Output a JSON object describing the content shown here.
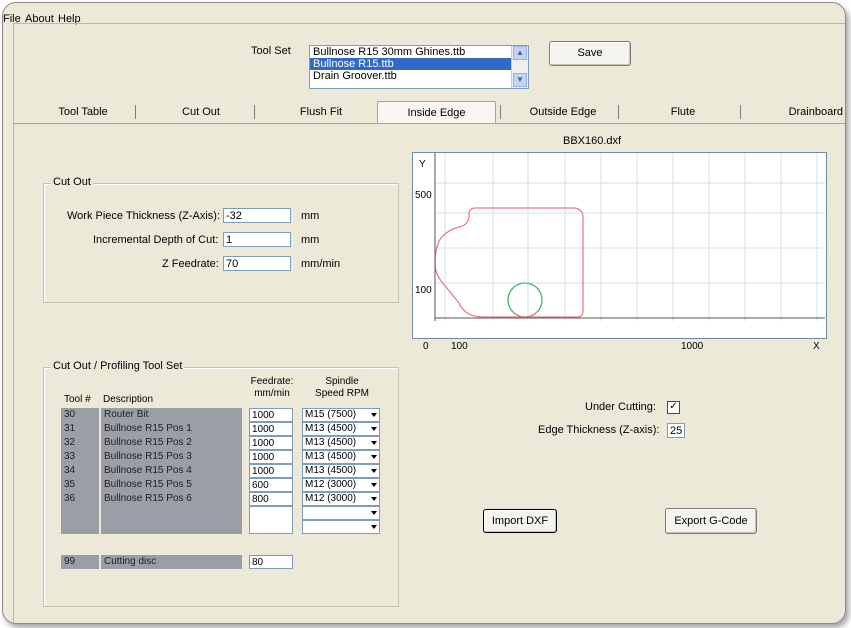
{
  "menu": [
    "File",
    "About",
    "Help"
  ],
  "toolset": {
    "label": "Tool Set",
    "options": [
      "Bullnose R15 30mm Ghines.ttb",
      "Bullnose R15.ttb",
      "Drain Groover.ttb"
    ],
    "selected_index": 1,
    "save_label": "Save"
  },
  "tabs": [
    "Tool Table",
    "Cut Out",
    "Flush Fit",
    "Inside Edge",
    "Outside Edge",
    "Flute",
    "Drainboard"
  ],
  "active_tab": "Inside Edge",
  "cutout": {
    "title": "Cut Out",
    "thickness_label": "Work Piece Thickness (Z-Axis):",
    "thickness_value": "-32",
    "thickness_unit": "mm",
    "depth_label": "Incremental Depth of Cut:",
    "depth_value": "1",
    "depth_unit": "mm",
    "feed_label": "Z Feedrate:",
    "feed_value": "70",
    "feed_unit": "mm/min"
  },
  "toolset_table": {
    "title": "Cut Out / Profiling Tool Set",
    "col_tool": "Tool #",
    "col_desc": "Description",
    "col_feed_1": "Feedrate:",
    "col_feed_2": "mm/min",
    "col_spindle_1": "Spindle",
    "col_spindle_2": "Speed RPM",
    "rows": [
      {
        "tool": "30",
        "desc": "Router Bit",
        "feed": "1000",
        "spindle": "M15 (7500)"
      },
      {
        "tool": "31",
        "desc": "Bullnose R15 Pos 1",
        "feed": "1000",
        "spindle": "M13 (4500)"
      },
      {
        "tool": "32",
        "desc": "Bullnose R15 Pos 2",
        "feed": "1000",
        "spindle": "M13 (4500)"
      },
      {
        "tool": "33",
        "desc": "Bullnose R15 Pos 3",
        "feed": "1000",
        "spindle": "M13 (4500)"
      },
      {
        "tool": "34",
        "desc": "Bullnose R15 Pos 4",
        "feed": "1000",
        "spindle": "M13 (4500)"
      },
      {
        "tool": "35",
        "desc": "Bullnose R15 Pos 5",
        "feed": "600",
        "spindle": "M12 (3000)"
      },
      {
        "tool": "36",
        "desc": "Bullnose R15 Pos 6",
        "feed": "800",
        "spindle": "M12 (3000)"
      },
      {
        "tool": "",
        "desc": "",
        "feed": "",
        "spindle": ""
      },
      {
        "tool": "",
        "desc": "",
        "feed": "",
        "spindle": ""
      },
      {
        "tool": "99",
        "desc": "Cutting disc",
        "feed": "80",
        "spindle": null
      }
    ]
  },
  "plot": {
    "title": "BBX160.dxf",
    "y_axis": "Y",
    "x_axis": "X",
    "y_ticks": [
      "500",
      "100",
      "0"
    ],
    "x_ticks": [
      "100",
      "1000"
    ]
  },
  "options": {
    "under_cutting_label": "Under Cutting:",
    "under_cutting_checked": true,
    "edge_thickness_label": "Edge Thickness (Z-axis):",
    "edge_thickness_value": "25"
  },
  "buttons": {
    "import": "Import DXF",
    "export": "Export G-Code"
  }
}
